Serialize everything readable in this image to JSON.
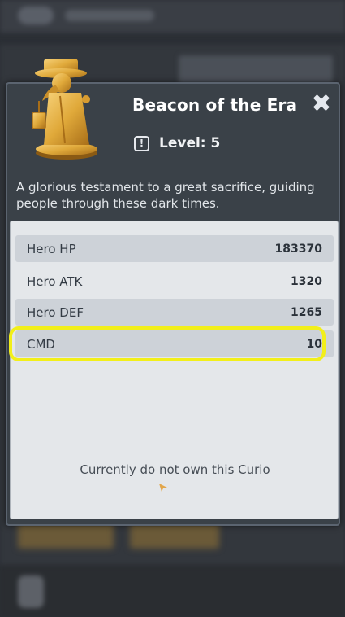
{
  "curio": {
    "title": "Beacon of the Era",
    "level_label": "Level: 5",
    "level_icon": "exclamation-icon",
    "description": "A glorious testament to a great sacrifice, guiding people through these dark times."
  },
  "stats": [
    {
      "name": "Hero HP",
      "value": "183370"
    },
    {
      "name": "Hero ATK",
      "value": "1320"
    },
    {
      "name": "Hero DEF",
      "value": "1265"
    },
    {
      "name": "CMD",
      "value": "10"
    }
  ],
  "ownership_status": "Currently do not own this Curio",
  "close_icon": "close-x-icon",
  "colors": {
    "highlight": "#f2ef1a",
    "gold": "#e0a93a",
    "modal_bg": "#3a4148",
    "stats_bg": "#e4e7ea"
  }
}
